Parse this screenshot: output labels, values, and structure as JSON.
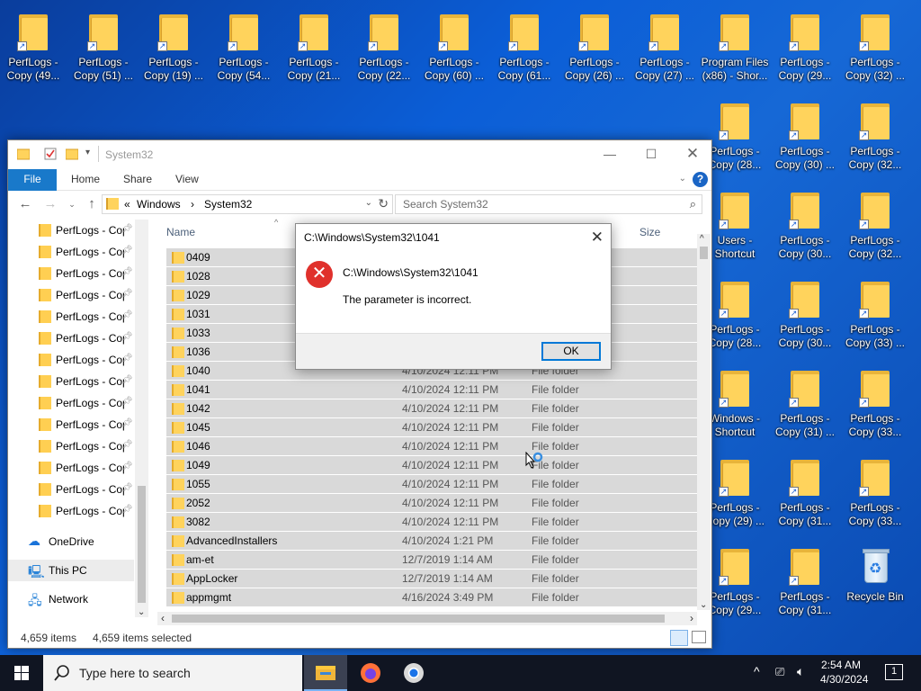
{
  "desktop": {
    "row1": [
      "PerfLogs - Copy (49...",
      "PerfLogs - Copy (51) ...",
      "PerfLogs - Copy (19) ...",
      "PerfLogs - Copy (54...",
      "PerfLogs - Copy (21...",
      "PerfLogs - Copy (22...",
      "PerfLogs - Copy (60) ...",
      "PerfLogs - Copy (61...",
      "PerfLogs - Copy (26) ...",
      "PerfLogs - Copy (27) ...",
      "Program Files (x86) - Shor...",
      "PerfLogs - Copy (29...",
      "PerfLogs - Copy (32) ..."
    ],
    "col_right": [
      [
        "PerfLogs - Copy (28...",
        "PerfLogs - Copy (30) ...",
        "PerfLogs - Copy (32..."
      ],
      [
        "Users - Shortcut",
        "PerfLogs - Copy (30...",
        "PerfLogs - Copy (32..."
      ],
      [
        "PerfLogs - Copy (28...",
        "PerfLogs - Copy (30...",
        "PerfLogs - Copy (33) ..."
      ],
      [
        "Windows - Shortcut",
        "PerfLogs - Copy (31) ...",
        "PerfLogs - Copy (33..."
      ],
      [
        "PerfLogs - Copy (29) ...",
        "PerfLogs - Copy (31...",
        "PerfLogs - Copy (33..."
      ],
      [
        "PerfLogs - Copy (29...",
        "PerfLogs - Copy (31...",
        "Recycle Bin"
      ]
    ]
  },
  "explorer": {
    "title": "System32",
    "tabs": [
      "File",
      "Home",
      "Share",
      "View"
    ],
    "address": {
      "chevron": "«",
      "crumb1": "Windows",
      "sep": "›",
      "crumb2": "System32"
    },
    "search_placeholder": "Search System32",
    "nav_items": [
      "PerfLogs - Copy",
      "PerfLogs - Copy",
      "PerfLogs - Copy",
      "PerfLogs - Copy",
      "PerfLogs - Copy",
      "PerfLogs - Copy",
      "PerfLogs - Copy",
      "PerfLogs - Copy",
      "PerfLogs - Copy",
      "PerfLogs - Copy",
      "PerfLogs - Copy",
      "PerfLogs - Copy",
      "PerfLogs - Copy",
      "PerfLogs - Copy"
    ],
    "onedrive": "OneDrive",
    "thispc": "This PC",
    "network": "Network",
    "columns": {
      "name": "Name",
      "size": "Size"
    },
    "files": [
      {
        "name": "0409",
        "date": "",
        "type": ""
      },
      {
        "name": "1028",
        "date": "",
        "type": ""
      },
      {
        "name": "1029",
        "date": "",
        "type": ""
      },
      {
        "name": "1031",
        "date": "",
        "type": ""
      },
      {
        "name": "1033",
        "date": "",
        "type": ""
      },
      {
        "name": "1036",
        "date": "",
        "type": ""
      },
      {
        "name": "1040",
        "date": "4/10/2024 12:11 PM",
        "type": "File folder"
      },
      {
        "name": "1041",
        "date": "4/10/2024 12:11 PM",
        "type": "File folder"
      },
      {
        "name": "1042",
        "date": "4/10/2024 12:11 PM",
        "type": "File folder"
      },
      {
        "name": "1045",
        "date": "4/10/2024 12:11 PM",
        "type": "File folder"
      },
      {
        "name": "1046",
        "date": "4/10/2024 12:11 PM",
        "type": "File folder"
      },
      {
        "name": "1049",
        "date": "4/10/2024 12:11 PM",
        "type": "File folder"
      },
      {
        "name": "1055",
        "date": "4/10/2024 12:11 PM",
        "type": "File folder"
      },
      {
        "name": "2052",
        "date": "4/10/2024 12:11 PM",
        "type": "File folder"
      },
      {
        "name": "3082",
        "date": "4/10/2024 12:11 PM",
        "type": "File folder"
      },
      {
        "name": "AdvancedInstallers",
        "date": "4/10/2024 1:21 PM",
        "type": "File folder"
      },
      {
        "name": "am-et",
        "date": "12/7/2019 1:14 AM",
        "type": "File folder"
      },
      {
        "name": "AppLocker",
        "date": "12/7/2019 1:14 AM",
        "type": "File folder"
      },
      {
        "name": "appmgmt",
        "date": "4/16/2024 3:49 PM",
        "type": "File folder"
      }
    ],
    "status_count": "4,659 items",
    "status_selected": "4,659 items selected"
  },
  "dialog": {
    "title": "C:\\Windows\\System32\\1041",
    "path": "C:\\Windows\\System32\\1041",
    "message": "The parameter is incorrect.",
    "ok": "OK"
  },
  "taskbar": {
    "search_placeholder": "Type here to search",
    "time": "2:54 AM",
    "date": "4/30/2024",
    "notification_count": "1"
  }
}
